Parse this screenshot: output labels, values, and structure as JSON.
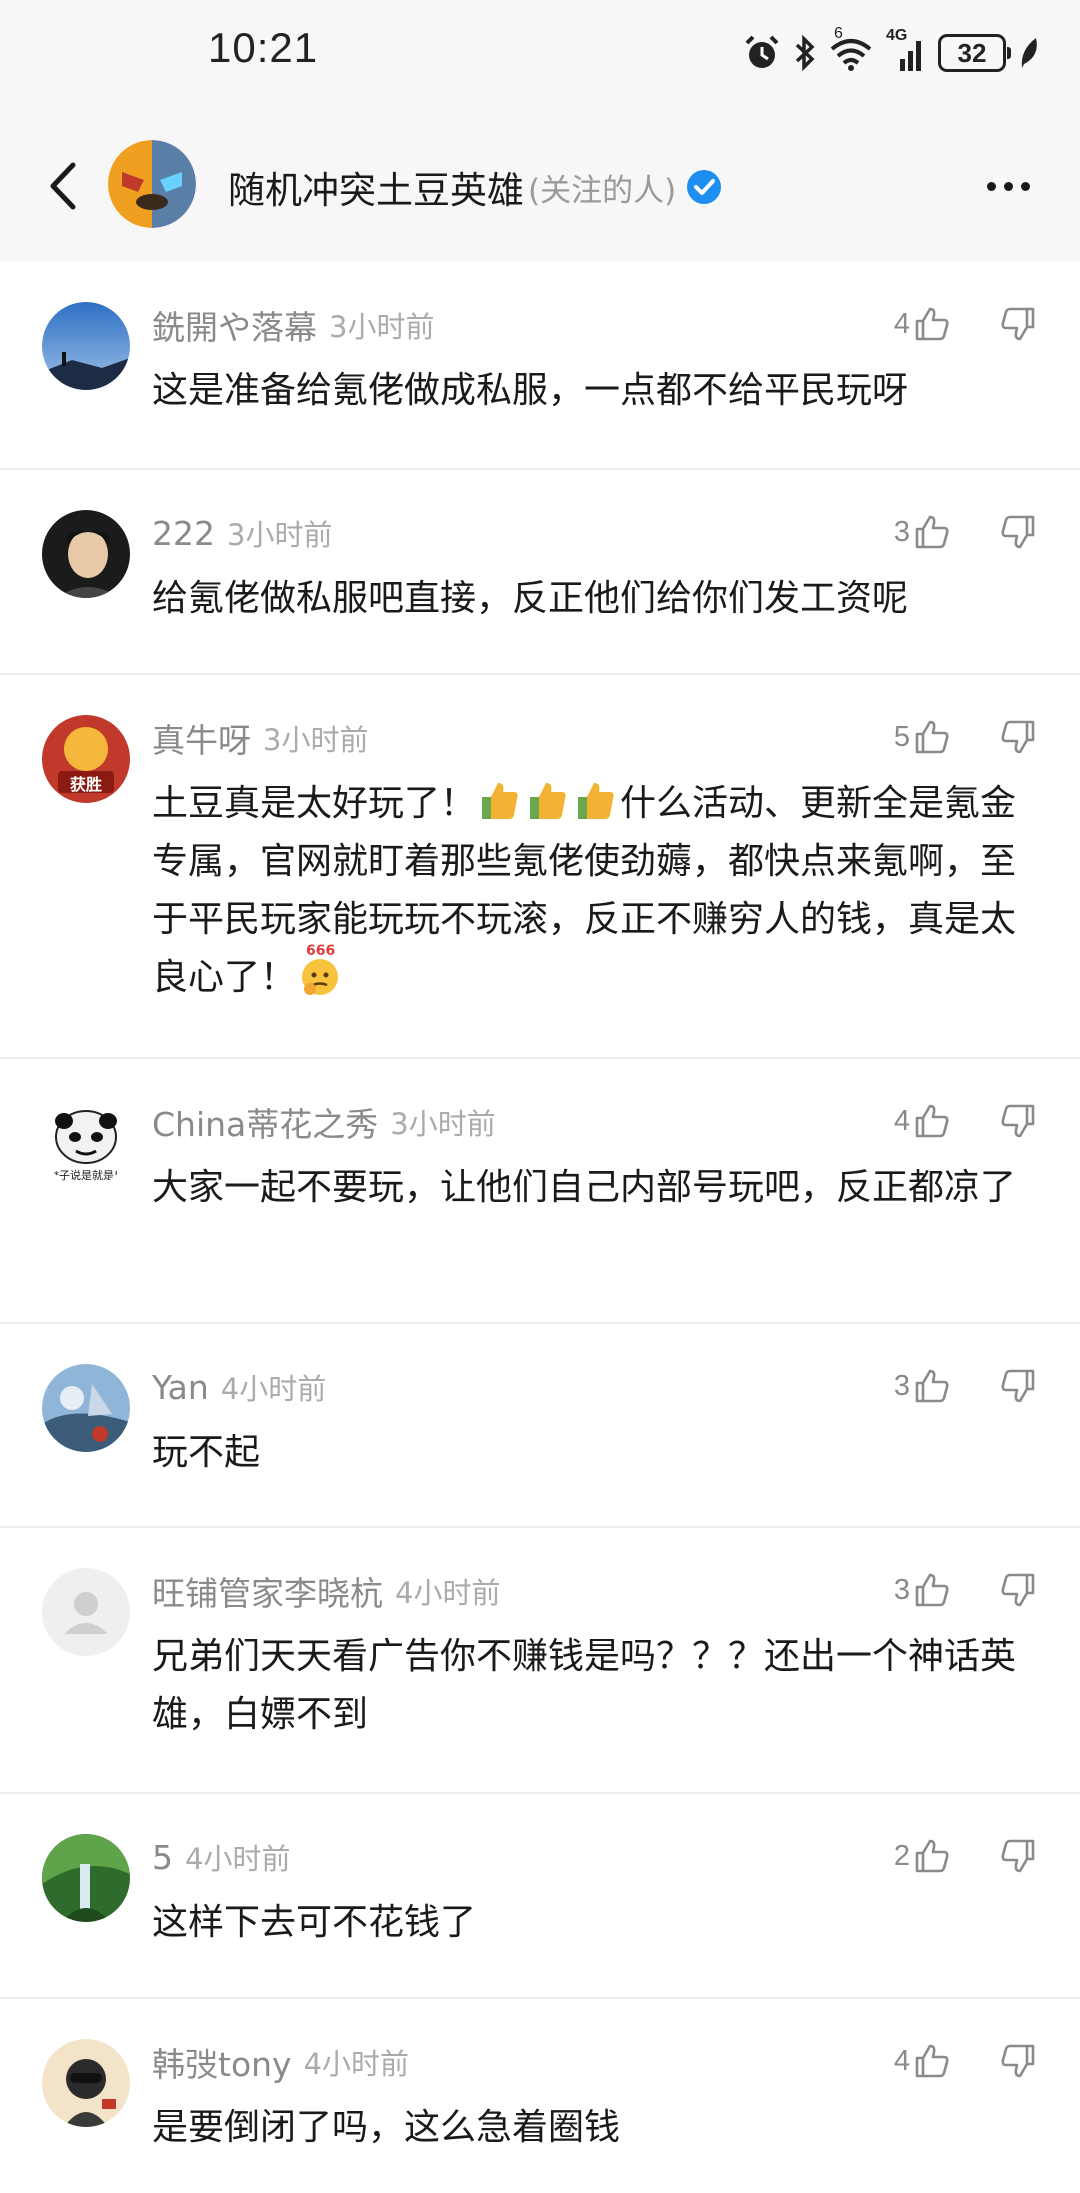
{
  "status_bar": {
    "time": "10:21",
    "battery": "32",
    "network": "4G",
    "wifi_badge": "6",
    "icons": [
      "alarm-icon",
      "bluetooth-icon",
      "wifi-icon",
      "signal-icon",
      "battery-icon",
      "leaf-icon"
    ]
  },
  "header": {
    "name": "随机冲突土豆英雄",
    "follow_tag": "(关注的人)",
    "icons": [
      "back-icon",
      "verified-icon",
      "more-icon"
    ]
  },
  "colors": {
    "verified": "#1e8ff0",
    "meta_text": "#8a8a8a",
    "divider": "#ececec"
  },
  "comments": [
    {
      "user": "銑開や落幕",
      "time": "3小时前",
      "likes": "4",
      "text": "这是准备给氪佬做成私服，一点都不给平民玩呀"
    },
    {
      "user": "222",
      "time": "3小时前",
      "likes": "3",
      "text": "给氪佬做私服吧直接，反正他们给你们发工资呢"
    },
    {
      "user": "真牛呀",
      "time": "3小时前",
      "likes": "5",
      "avatar_caption": "获胜",
      "text_a": "土豆真是太好玩了！",
      "text_b": "什么活动、更新全是氪金专属，官网就盯着那些氪佬使劲薅，都快点来氪啊，至于平民玩家能玩玩不玩滚，反正不赚穷人的钱，真是太良心了！",
      "emoji_badge": "666"
    },
    {
      "user": "China蒂花之秀",
      "time": "3小时前",
      "likes": "4",
      "avatar_caption": "*子说是就是!",
      "text": "大家一起不要玩，让他们自己内部号玩吧，反正都凉了"
    },
    {
      "user": "Yan",
      "time": "4小时前",
      "likes": "3",
      "text": "玩不起"
    },
    {
      "user": "旺铺管家李晓杭",
      "time": "4小时前",
      "likes": "3",
      "text": "兄弟们天天看广告你不赚钱是吗？？？还出一个神话英雄，白嫖不到"
    },
    {
      "user": "5",
      "time": "4小时前",
      "likes": "2",
      "text": "这样下去可不花钱了"
    },
    {
      "user": "韩弢tony",
      "time": "4小时前",
      "likes": "4",
      "text": "是要倒闭了吗，这么急着圈钱"
    }
  ]
}
